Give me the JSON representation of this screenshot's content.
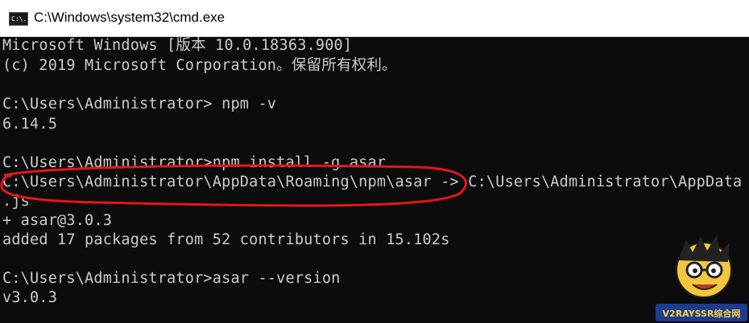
{
  "window": {
    "icon_label": "C:\\.",
    "title": "C:\\Windows\\system32\\cmd.exe"
  },
  "console": {
    "lines": [
      "Microsoft Windows [版本 10.0.18363.900]",
      "(c) 2019 Microsoft Corporation。保留所有权利。",
      "",
      "C:\\Users\\Administrator> npm -v",
      "6.14.5",
      "",
      "C:\\Users\\Administrator>npm install -g asar",
      "C:\\Users\\Administrator\\AppData\\Roaming\\npm\\asar -> C:\\Users\\Administrator\\AppData",
      ".js",
      "+ asar@3.0.3",
      "added 17 packages from 52 contributors in 15.102s",
      "",
      "C:\\Users\\Administrator>asar --version",
      "v3.0.3"
    ]
  },
  "annotation": {
    "color": "#e8141c",
    "shape": "ellipse-outline"
  },
  "watermark": {
    "text": "V2RAYSSR综合网"
  }
}
